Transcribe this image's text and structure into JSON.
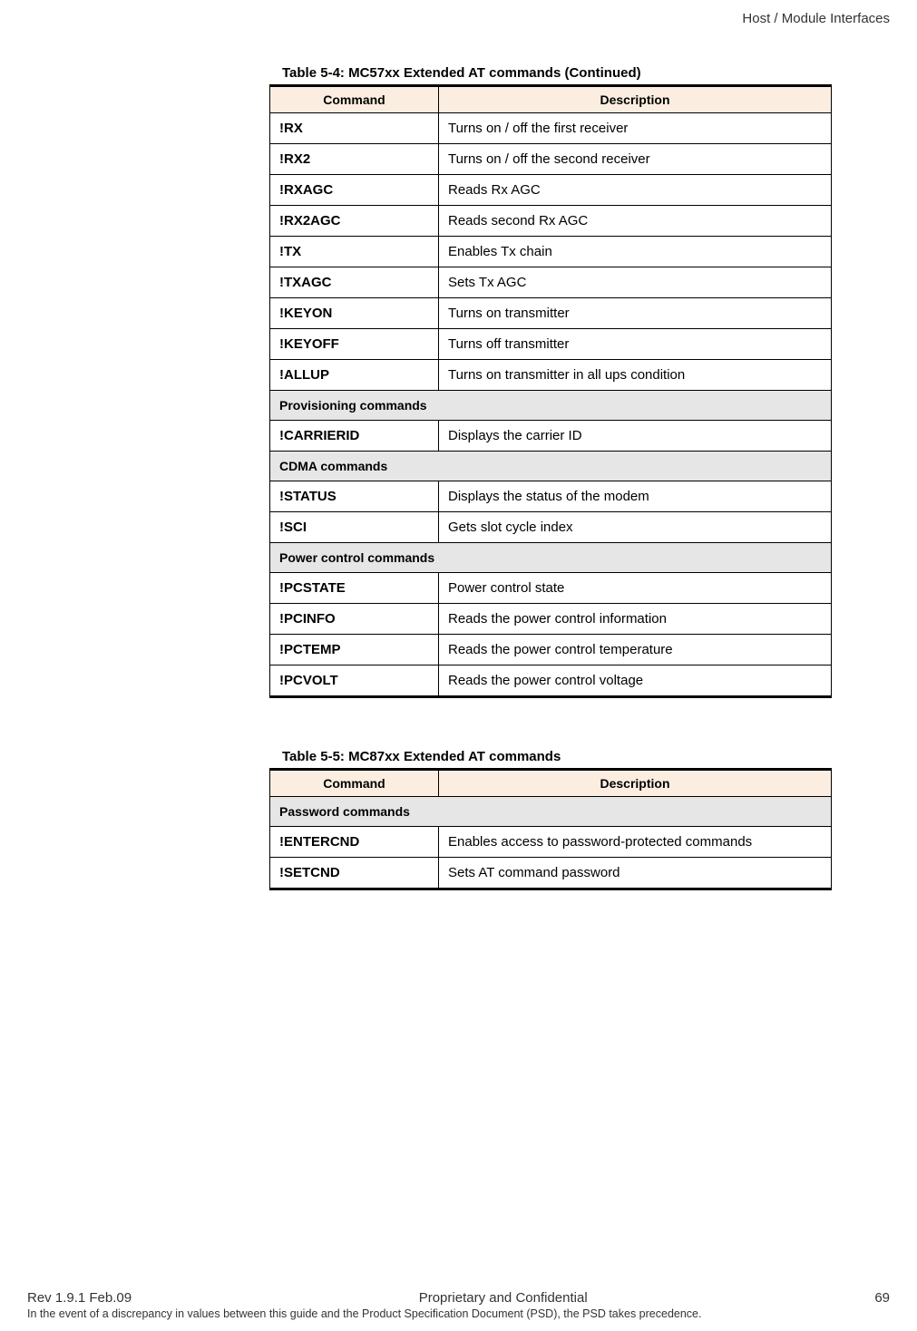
{
  "header": {
    "section": "Host / Module Interfaces"
  },
  "table1": {
    "caption": "Table 5-4:  MC57xx Extended AT commands (Continued)",
    "headers": [
      "Command",
      "Description"
    ],
    "rows": [
      {
        "type": "row",
        "cmd": "!RX",
        "desc": "Turns on / off the first receiver"
      },
      {
        "type": "row",
        "cmd": "!RX2",
        "desc": "Turns on / off the second receiver"
      },
      {
        "type": "row",
        "cmd": "!RXAGC",
        "desc": "Reads Rx AGC"
      },
      {
        "type": "row",
        "cmd": "!RX2AGC",
        "desc": "Reads second Rx AGC"
      },
      {
        "type": "row",
        "cmd": "!TX",
        "desc": "Enables Tx chain"
      },
      {
        "type": "row",
        "cmd": "!TXAGC",
        "desc": "Sets Tx AGC"
      },
      {
        "type": "row",
        "cmd": "!KEYON",
        "desc": "Turns on transmitter"
      },
      {
        "type": "row",
        "cmd": "!KEYOFF",
        "desc": "Turns off transmitter"
      },
      {
        "type": "row",
        "cmd": "!ALLUP",
        "desc": "Turns on transmitter in all ups condition"
      },
      {
        "type": "section",
        "label": "Provisioning commands"
      },
      {
        "type": "row",
        "cmd": "!CARRIERID",
        "desc": "Displays the carrier ID"
      },
      {
        "type": "section",
        "label": "CDMA commands"
      },
      {
        "type": "row",
        "cmd": "!STATUS",
        "desc": "Displays the status of the modem"
      },
      {
        "type": "row",
        "cmd": "!SCI",
        "desc": "Gets slot cycle index"
      },
      {
        "type": "section",
        "label": "Power control commands"
      },
      {
        "type": "row",
        "cmd": "!PCSTATE",
        "desc": "Power control state"
      },
      {
        "type": "row",
        "cmd": "!PCINFO",
        "desc": "Reads the power control information"
      },
      {
        "type": "row",
        "cmd": "!PCTEMP",
        "desc": "Reads the power control temperature"
      },
      {
        "type": "row",
        "cmd": "!PCVOLT",
        "desc": "Reads the power control voltage"
      }
    ]
  },
  "table2": {
    "caption": "Table 5-5:  MC87xx Extended AT commands",
    "headers": [
      "Command",
      "Description"
    ],
    "rows": [
      {
        "type": "section",
        "label": "Password commands"
      },
      {
        "type": "row",
        "cmd": "!ENTERCND",
        "desc": "Enables access to password-protected commands"
      },
      {
        "type": "row",
        "cmd": "!SETCND",
        "desc": "Sets AT command password"
      }
    ]
  },
  "footer": {
    "rev": "Rev 1.9.1  Feb.09",
    "center": "Proprietary and Confidential",
    "page": "69",
    "note": "In the event of a discrepancy in values between this guide and the Product Specification Document (PSD), the PSD takes precedence."
  }
}
